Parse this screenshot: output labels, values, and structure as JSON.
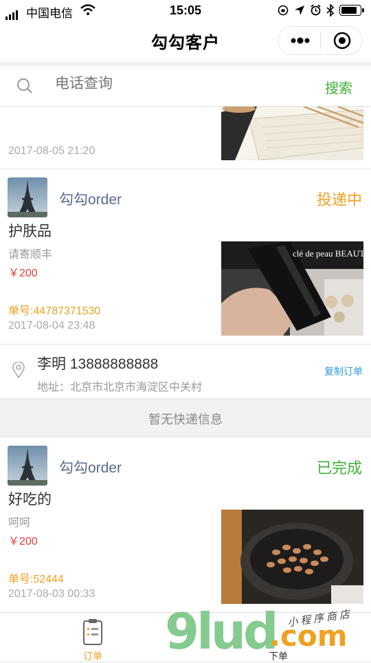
{
  "status_bar": {
    "carrier": "中国电信",
    "time": "15:05"
  },
  "nav": {
    "title": "勾勾客户"
  },
  "search": {
    "placeholder": "电话查询",
    "button": "搜索"
  },
  "orders": [
    {
      "date": "2017-08-05 21:20"
    },
    {
      "shop": "勾勾order",
      "status": "投递中",
      "status_color": "#f0a020",
      "product": "护肤品",
      "note": "请寄顺丰",
      "price": "￥200",
      "order_no": "单号:44787371530",
      "date": "2017-08-04 23:48",
      "image_text": "clé de peau BEAUTÉ",
      "contact": {
        "name_phone": "李明 13888888888",
        "address": "地址：北京市北京市海淀区中关村",
        "copy_label": "复制订单"
      },
      "express": "暂无快递信息"
    },
    {
      "shop": "勾勾order",
      "status": "已完成",
      "status_color": "#3cb034",
      "product": "好吃的",
      "note": "呵呵",
      "price": "￥200",
      "order_no": "单号:52444",
      "date": "2017-08-03 00:33"
    }
  ],
  "tabbar": {
    "orders_label": "订单",
    "place_order_label": "下单"
  },
  "watermark": {
    "brand": "9lud",
    "com": ".com",
    "tagline": "小程序商店"
  },
  "colors": {
    "accent_green": "#3cb034",
    "accent_orange": "#f0a020",
    "price_red": "#e2403a",
    "shop_blue": "#5a6a93"
  }
}
